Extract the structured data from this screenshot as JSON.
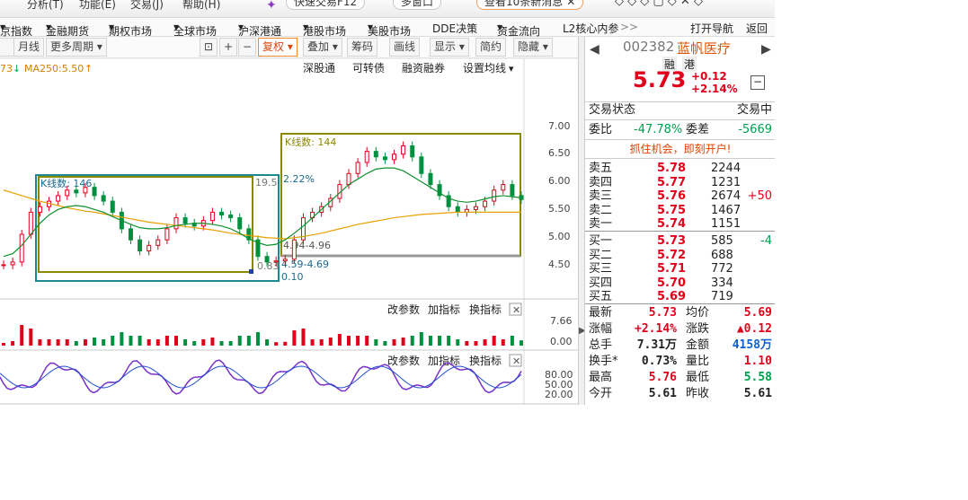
{
  "topbar": {
    "items": [
      "分析(T)",
      "功能(E)",
      "交易(J)",
      "帮助(H)"
    ],
    "quick_trade": "快速交易F12",
    "multi_window": "多窗口",
    "news": "查看10条新消息"
  },
  "menu": {
    "items": [
      "京指数",
      "金融期货",
      "期权市场",
      "全球市场",
      "沪深港通",
      "港股市场",
      "美股市场",
      "DDE决策",
      "资金流向",
      "L2核心内参"
    ],
    "more": ">>",
    "open_nav": "打开导航",
    "back": "返回"
  },
  "toolbar": {
    "month": "月线",
    "more_periods": "更多周期",
    "reset_rights": "复权",
    "overlay": "叠加",
    "chips": "筹码",
    "draw": "画线",
    "display": "显示",
    "simple": "简约",
    "hide": "隐藏"
  },
  "chart_links": {
    "shenzhen": "深股通",
    "convertible": "可转债",
    "margin": "融资融券",
    "ma_settings": "设置均线"
  },
  "ma_legend": {
    "prefix": "73",
    "ma250": "MA250:5.50"
  },
  "chart_data": {
    "type": "line",
    "price_axis": {
      "ticks": [
        "7.00",
        "6.50",
        "6.00",
        "5.50",
        "5.00",
        "4.50"
      ],
      "ylim": [
        4.2,
        7.2
      ]
    },
    "volume_axis": {
      "ticks": [
        "7.66",
        "0.00"
      ]
    },
    "osc_axis": {
      "ticks": [
        "80.00",
        "50.00",
        "20.00"
      ]
    },
    "boxes": [
      {
        "label": "K线数: 146",
        "high_value": "19.5",
        "low_range": "4.59-4.69",
        "bottom_value": "0.10",
        "corner_value": "0.83"
      },
      {
        "label": "K线数: 144",
        "range": "4.94-4.96",
        "top_pct": "2.22%"
      }
    ],
    "close": [
      4.55,
      4.6,
      5.1,
      5.5,
      5.6,
      5.7,
      5.8,
      5.9,
      5.85,
      5.95,
      5.8,
      5.7,
      5.5,
      5.2,
      5.0,
      4.8,
      4.9,
      5.0,
      5.2,
      5.4,
      5.3,
      5.25,
      5.35,
      5.5,
      5.45,
      5.4,
      5.2,
      5.0,
      4.7,
      4.6,
      4.62,
      4.65,
      5.0,
      5.4,
      5.5,
      5.6,
      5.75,
      6.0,
      6.2,
      6.4,
      6.6,
      6.5,
      6.45,
      6.55,
      6.7,
      6.5,
      6.2,
      6.0,
      5.8,
      5.6,
      5.5,
      5.55,
      5.6,
      5.7,
      5.9,
      6.0,
      5.8,
      5.73
    ],
    "ma_short": [
      4.7,
      4.75,
      4.9,
      5.1,
      5.3,
      5.45,
      5.55,
      5.6,
      5.62,
      5.6,
      5.55,
      5.5,
      5.42,
      5.35,
      5.28,
      5.22,
      5.2,
      5.2,
      5.22,
      5.26,
      5.28,
      5.3,
      5.3,
      5.28,
      5.25,
      5.2,
      5.12,
      5.02,
      4.95,
      4.9,
      4.92,
      5.0,
      5.12,
      5.25,
      5.4,
      5.55,
      5.7,
      5.85,
      6.0,
      6.1,
      6.2,
      6.28,
      6.3,
      6.3,
      6.25,
      6.15,
      6.05,
      5.95,
      5.85,
      5.75,
      5.7,
      5.68,
      5.7,
      5.74,
      5.78,
      5.8,
      5.78,
      5.76
    ],
    "ma250": [
      5.9,
      5.85,
      5.8,
      5.75,
      5.7,
      5.66,
      5.62,
      5.58,
      5.55,
      5.52,
      5.5,
      5.47,
      5.44,
      5.41,
      5.38,
      5.35,
      5.32,
      5.3,
      5.28,
      5.26,
      5.24,
      5.22,
      5.2,
      5.18,
      5.15,
      5.12,
      5.1,
      5.08,
      5.06,
      5.04,
      5.03,
      5.02,
      5.04,
      5.06,
      5.09,
      5.12,
      5.16,
      5.2,
      5.24,
      5.28,
      5.31,
      5.34,
      5.37,
      5.4,
      5.42,
      5.44,
      5.46,
      5.47,
      5.48,
      5.49,
      5.5,
      5.5,
      5.5,
      5.5,
      5.5,
      5.5,
      5.5,
      5.5
    ],
    "panel_links": {
      "params": "改参数",
      "add_indicator": "加指标",
      "switch_indicator": "换指标"
    }
  },
  "quote": {
    "code": "002382",
    "name": "蓝帆医疗",
    "tags": [
      "融",
      "港"
    ],
    "price": "5.73",
    "change": "+0.12",
    "change_pct": "+2.14%",
    "status_label": "交易状态",
    "status_value": "交易中",
    "ratio_label": "委比",
    "ratio_value": "-47.78%",
    "diff_label": "委差",
    "diff_value": "-5669",
    "promo": "抓住机会，即刻开户!",
    "asks": [
      {
        "label": "卖五",
        "price": "5.78",
        "vol": "2244",
        "chg": ""
      },
      {
        "label": "卖四",
        "price": "5.77",
        "vol": "1231",
        "chg": ""
      },
      {
        "label": "卖三",
        "price": "5.76",
        "vol": "2674",
        "chg": "+50"
      },
      {
        "label": "卖二",
        "price": "5.75",
        "vol": "1467",
        "chg": ""
      },
      {
        "label": "卖一",
        "price": "5.74",
        "vol": "1151",
        "chg": ""
      }
    ],
    "bids": [
      {
        "label": "买一",
        "price": "5.73",
        "vol": "585",
        "chg": "-4"
      },
      {
        "label": "买二",
        "price": "5.72",
        "vol": "688",
        "chg": ""
      },
      {
        "label": "买三",
        "price": "5.71",
        "vol": "772",
        "chg": ""
      },
      {
        "label": "买四",
        "price": "5.70",
        "vol": "334",
        "chg": ""
      },
      {
        "label": "买五",
        "price": "5.69",
        "vol": "719",
        "chg": ""
      }
    ],
    "stats": [
      {
        "l1": "最新",
        "v1": "5.73",
        "l2": "均价",
        "v2": "5.69"
      },
      {
        "l1": "涨幅",
        "v1": "+2.14%",
        "l2": "涨跌",
        "v2": "▲0.12"
      },
      {
        "l1": "总手",
        "v1": "7.31万",
        "l2": "金额",
        "v2": "4158万"
      },
      {
        "l1": "换手*",
        "v1": "0.73%",
        "l2": "量比",
        "v2": "1.10"
      },
      {
        "l1": "最高",
        "v1": "5.76",
        "l2": "最低",
        "v2": "5.58"
      },
      {
        "l1": "今开",
        "v1": "5.61",
        "l2": "昨收",
        "v2": "5.61"
      }
    ]
  }
}
